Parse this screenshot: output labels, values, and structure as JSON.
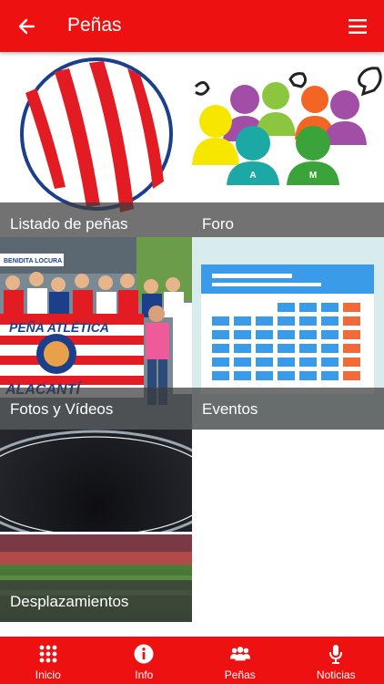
{
  "app_bar": {
    "title": "Peñas"
  },
  "tiles": [
    {
      "label": "Listado de peñas"
    },
    {
      "label": "Foro"
    },
    {
      "label": "Fotos y Vídeos"
    },
    {
      "label": "Eventos"
    },
    {
      "label": "Desplazamientos"
    }
  ],
  "forum_art": {
    "letters": [
      "A",
      "M"
    ]
  },
  "photo_art": {
    "banner_text": "PEÑA ATLÉTICA",
    "city_text": "ALACANTÍ",
    "sign_text": "BENIDITA  LOCURA"
  },
  "bottom_nav": [
    {
      "label": "Inicio",
      "icon": "grid-icon"
    },
    {
      "label": "Info",
      "icon": "info-icon"
    },
    {
      "label": "Peñas",
      "icon": "group-icon"
    },
    {
      "label": "Noticias",
      "icon": "microphone-icon"
    }
  ],
  "colors": {
    "primary": "#ee1111",
    "caption_overlay": "#3c3c3c",
    "calendar_blue": "#3a9be8",
    "calendar_orange": "#f26a3a"
  }
}
